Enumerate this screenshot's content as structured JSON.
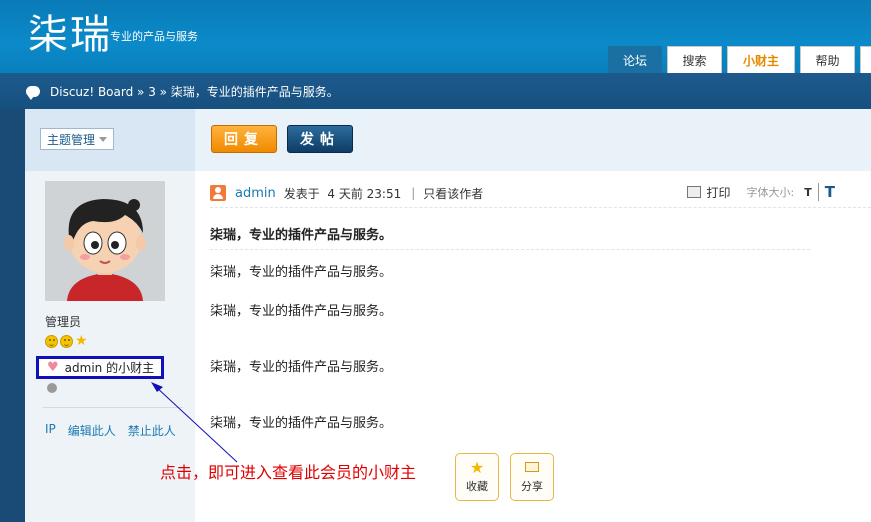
{
  "header": {
    "logo": "柒瑞",
    "slogan": "专业的产品与服务",
    "tabs": [
      {
        "label": "论坛"
      },
      {
        "label": "搜索"
      },
      {
        "label": "小财主"
      },
      {
        "label": "帮助"
      },
      {
        "label": ""
      }
    ]
  },
  "breadcrumb": {
    "text": "Discuz! Board » 3 » 柒瑞，专业的插件产品与服务。"
  },
  "toolbar": {
    "manage_label": "主题管理",
    "reply_label": "回复",
    "post_label": "发帖"
  },
  "user": {
    "role": "管理员",
    "wallet_link": "admin 的小财主",
    "links": [
      "IP",
      "编辑此人",
      "禁止此人"
    ]
  },
  "post": {
    "author": "admin",
    "posted_at": "发表于  4 天前 23:51",
    "separator": "|",
    "only_author": "只看该作者",
    "print_label": "打印",
    "font_size_label": "字体大小:",
    "font_small": "T",
    "font_large": "T",
    "title": "柒瑞，专业的插件产品与服务。",
    "paragraphs": [
      "柒瑞，专业的插件产品与服务。",
      "柒瑞，专业的插件产品与服务。",
      "柒瑞，专业的插件产品与服务。",
      "柒瑞，专业的插件产品与服务。"
    ],
    "favorite_label": "收藏",
    "share_label": "分享"
  },
  "annotation": "点击，即可进入查看此会员的小财主",
  "colors": {
    "header_blue": "#0b8ac9",
    "nav_dark": "#16507f",
    "reply_orange": "#f08a00",
    "post_navy": "#0e3c66",
    "highlight_box": "#1010b8",
    "annotation_red": "#e00000"
  }
}
